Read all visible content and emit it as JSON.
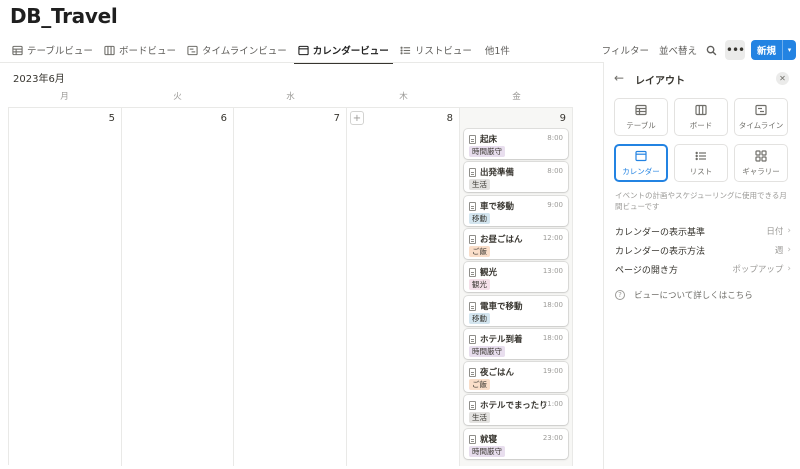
{
  "page": {
    "title": "DB_Travel"
  },
  "views": [
    {
      "label": "テーブルビュー",
      "icon": "table-icon"
    },
    {
      "label": "ボードビュー",
      "icon": "board-icon"
    },
    {
      "label": "タイムラインビュー",
      "icon": "timeline-icon"
    },
    {
      "label": "カレンダービュー",
      "icon": "calendar-icon",
      "active": true
    },
    {
      "label": "リストビュー",
      "icon": "list-icon"
    },
    {
      "label": "他1件"
    }
  ],
  "toolbar": {
    "filter": "フィルター",
    "sort": "並べ替え",
    "more": "•••",
    "new": "新規",
    "new_caret": "▾"
  },
  "calendar": {
    "month": "2023年6月",
    "weekdays": [
      "月",
      "火",
      "水",
      "木",
      "金"
    ],
    "days": [
      "5",
      "6",
      "7",
      "8",
      "9"
    ],
    "add_symbol": "+",
    "events": [
      {
        "name": "起床",
        "time": "8:00",
        "tag": "時間厳守",
        "tag_color": "#e8deee"
      },
      {
        "name": "出発準備",
        "time": "8:00",
        "tag": "生活",
        "tag_color": "#e3e2e0"
      },
      {
        "name": "車で移動",
        "time": "9:00",
        "tag": "移動",
        "tag_color": "#d3e5ef"
      },
      {
        "name": "お昼ごはん",
        "time": "12:00",
        "tag": "ご飯",
        "tag_color": "#fadec9"
      },
      {
        "name": "観光",
        "time": "13:00",
        "tag": "観光",
        "tag_color": "#f5e0e9"
      },
      {
        "name": "電車で移動",
        "time": "18:00",
        "tag": "移動",
        "tag_color": "#d3e5ef"
      },
      {
        "name": "ホテル到着",
        "time": "18:00",
        "tag": "時間厳守",
        "tag_color": "#e8deee"
      },
      {
        "name": "夜ごはん",
        "time": "19:00",
        "tag": "ご飯",
        "tag_color": "#fadec9"
      },
      {
        "name": "ホテルでまったり",
        "time": "21:00",
        "tag": "生活",
        "tag_color": "#e3e2e0"
      },
      {
        "name": "就寝",
        "time": "23:00",
        "tag": "時間厳守",
        "tag_color": "#e8deee"
      }
    ]
  },
  "panel": {
    "back": "←",
    "title": "レイアウト",
    "close": "✕",
    "layouts": [
      {
        "label": "テーブル",
        "icon": "table-icon"
      },
      {
        "label": "ボード",
        "icon": "board-icon"
      },
      {
        "label": "タイムライン",
        "icon": "timeline-icon"
      },
      {
        "label": "カレンダー",
        "icon": "calendar-icon",
        "selected": true
      },
      {
        "label": "リスト",
        "icon": "list-icon"
      },
      {
        "label": "ギャラリー",
        "icon": "gallery-icon"
      }
    ],
    "description": "イベントの計画やスケジューリングに使用できる月間ビューです",
    "settings": [
      {
        "label": "カレンダーの表示基準",
        "value": "日付"
      },
      {
        "label": "カレンダーの表示方法",
        "value": "週"
      },
      {
        "label": "ページの開き方",
        "value": "ポップアップ"
      }
    ],
    "chevron": "›",
    "help_icon": "?",
    "help": "ビューについて詳しくはこちら"
  },
  "colors": {
    "accent": "#2383e2"
  }
}
